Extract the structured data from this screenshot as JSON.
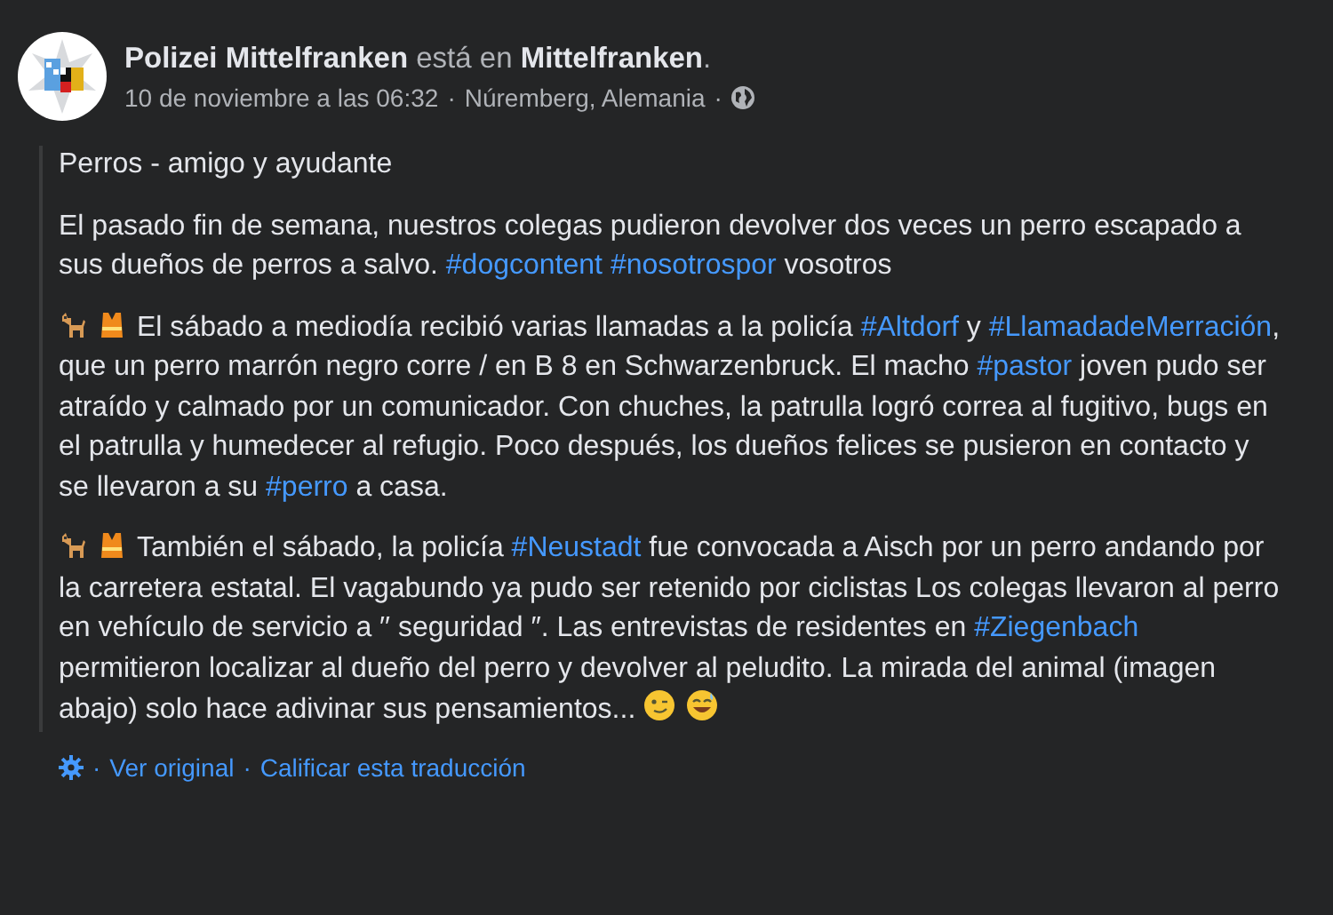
{
  "header": {
    "author": "Polizei Mittelfranken",
    "verb": "está en",
    "place": "Mittelfranken",
    "end": ".",
    "date": "10 de noviembre a las 06:32",
    "separator": "·",
    "location": "Núremberg, Alemania"
  },
  "paragraphs": [
    {
      "segments": [
        {
          "kind": "text",
          "text": "Perros - amigo y ayudante"
        }
      ]
    },
    {
      "segments": [
        {
          "kind": "text",
          "text": "El pasado fin de semana, nuestros colegas pudieron devolver dos veces un perro escapado a sus dueños de perros a salvo. "
        },
        {
          "kind": "hashtag",
          "text": "#dogcontent"
        },
        {
          "kind": "space"
        },
        {
          "kind": "hashtag",
          "text": "#nosotrospor"
        },
        {
          "kind": "text",
          "text": " vosotros"
        }
      ]
    },
    {
      "segments": [
        {
          "kind": "dog"
        },
        {
          "kind": "vest"
        },
        {
          "kind": "text",
          "text": "El sábado a mediodía recibió varias llamadas a la policía "
        },
        {
          "kind": "hashtag",
          "text": "#Altdorf"
        },
        {
          "kind": "text",
          "text": " y "
        },
        {
          "kind": "hashtag",
          "text": "#LlamadadeMerración"
        },
        {
          "kind": "text",
          "text": ", que un perro marrón negro corre / en B 8 en Schwarzenbruck. El macho "
        },
        {
          "kind": "hashtag",
          "text": "#pastor"
        },
        {
          "kind": "text",
          "text": " joven pudo ser atraído y calmado por un comunicador. Con chuches, la patrulla logró correa al fugitivo, bugs en el patrulla y humedecer al refugio. Poco después, los dueños felices se pusieron en contacto y se llevaron a su "
        },
        {
          "kind": "hashtag",
          "text": "#perro"
        },
        {
          "kind": "text",
          "text": " a casa."
        }
      ]
    },
    {
      "segments": [
        {
          "kind": "dog"
        },
        {
          "kind": "vest"
        },
        {
          "kind": "text",
          "text": "También el sábado, la policía "
        },
        {
          "kind": "hashtag",
          "text": "#Neustadt"
        },
        {
          "kind": "text",
          "text": " fue convocada a Aisch por un perro andando por la carretera estatal. El vagabundo ya pudo ser retenido por ciclistas Los colegas llevaron al perro en vehículo de servicio a ′′ seguridad ″. Las entrevistas de residentes en "
        },
        {
          "kind": "hashtag",
          "text": "#Ziegenbach"
        },
        {
          "kind": "text",
          "text": " permitieron localizar al dueño del perro y devolver al peludito. La mirada del animal (imagen abajo) solo hace adivinar sus pensamientos... "
        },
        {
          "kind": "wink"
        },
        {
          "kind": "sweat"
        }
      ]
    }
  ],
  "footer": {
    "separator": "·",
    "links": [
      "Ver original",
      "Calificar esta traducción"
    ]
  }
}
